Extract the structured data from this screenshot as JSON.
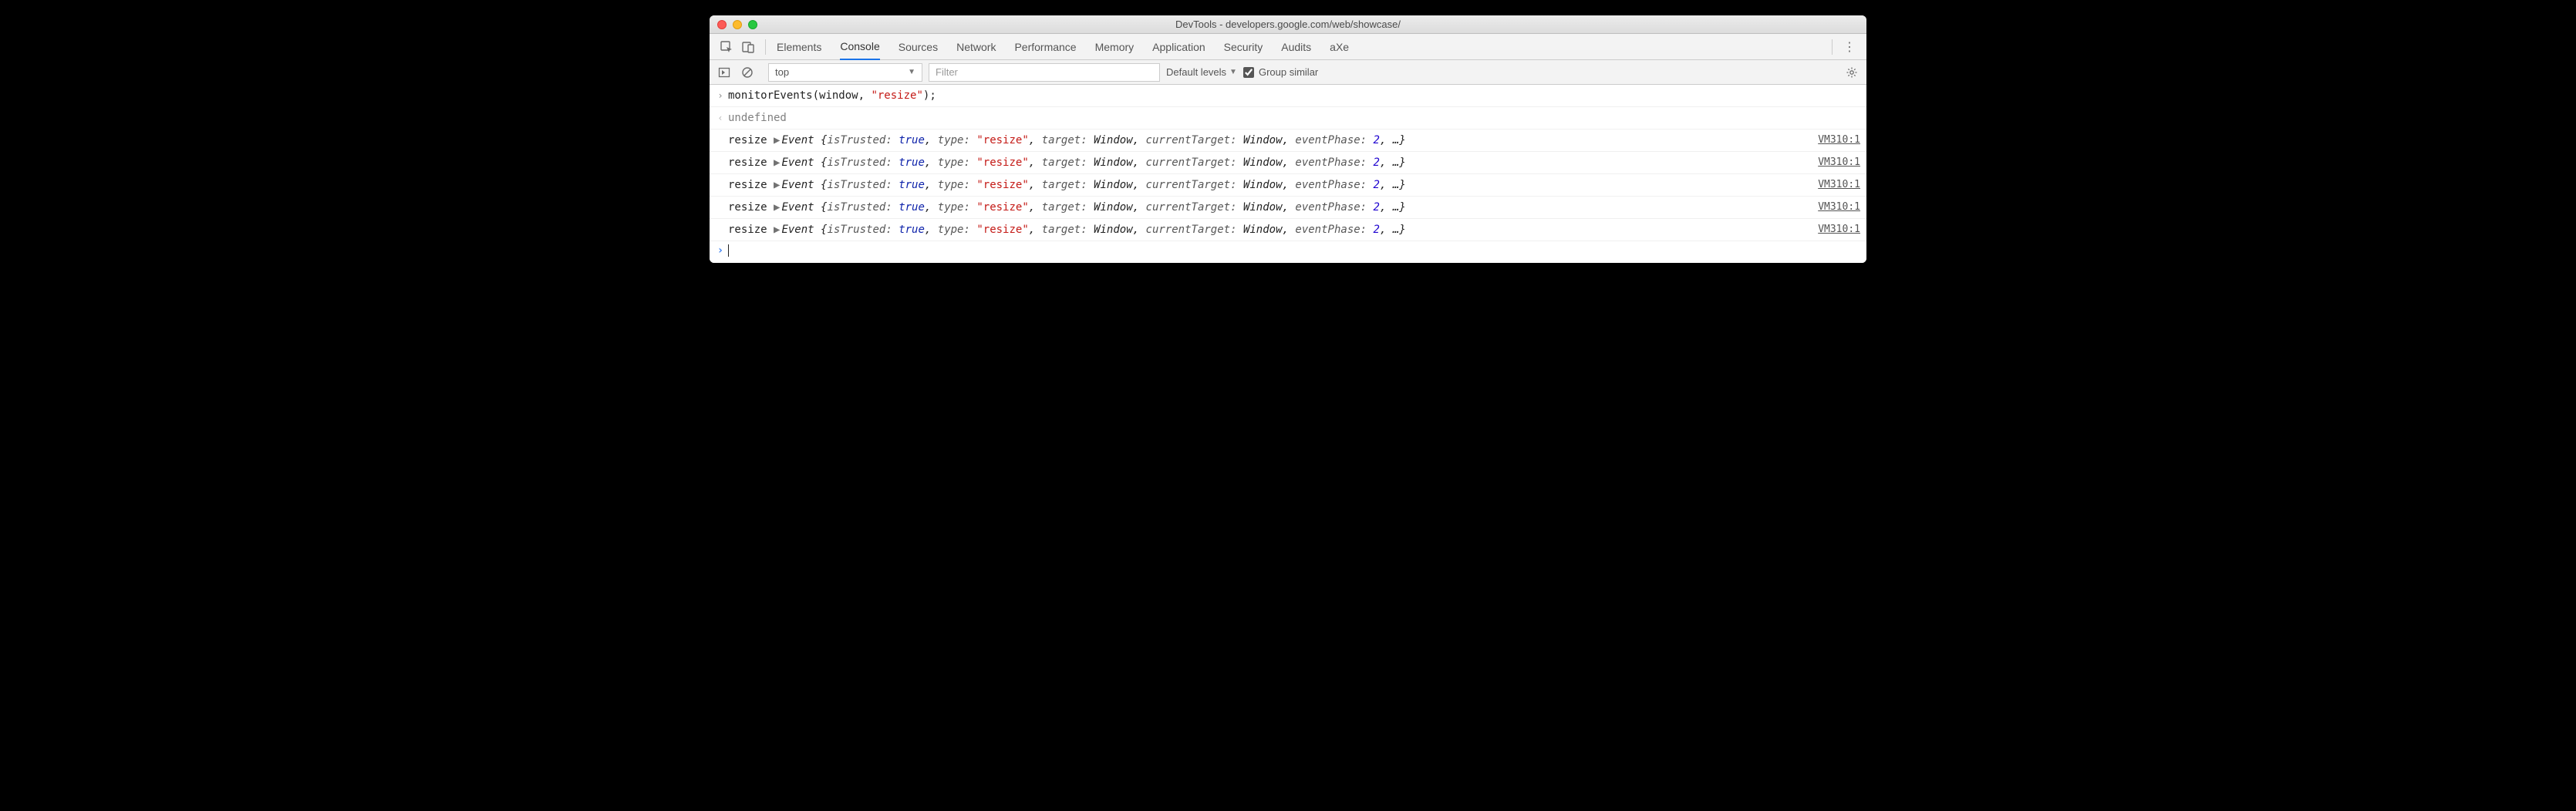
{
  "window": {
    "title": "DevTools - developers.google.com/web/showcase/"
  },
  "tabs": {
    "items": [
      "Elements",
      "Console",
      "Sources",
      "Network",
      "Performance",
      "Memory",
      "Application",
      "Security",
      "Audits",
      "aXe"
    ],
    "active": "Console"
  },
  "toolbar": {
    "context": "top",
    "filter_placeholder": "Filter",
    "levels_label": "Default levels",
    "group_label": "Group similar",
    "group_checked": true
  },
  "console": {
    "input_line": {
      "fn": "monitorEvents",
      "arg1": "window",
      "arg2": "\"resize\""
    },
    "result": "undefined",
    "events": [
      {
        "name": "resize",
        "cls": "Event",
        "props": {
          "isTrusted": "true",
          "type": "\"resize\"",
          "target": "Window",
          "currentTarget": "Window",
          "eventPhase": "2"
        },
        "source": "VM310:1"
      },
      {
        "name": "resize",
        "cls": "Event",
        "props": {
          "isTrusted": "true",
          "type": "\"resize\"",
          "target": "Window",
          "currentTarget": "Window",
          "eventPhase": "2"
        },
        "source": "VM310:1"
      },
      {
        "name": "resize",
        "cls": "Event",
        "props": {
          "isTrusted": "true",
          "type": "\"resize\"",
          "target": "Window",
          "currentTarget": "Window",
          "eventPhase": "2"
        },
        "source": "VM310:1"
      },
      {
        "name": "resize",
        "cls": "Event",
        "props": {
          "isTrusted": "true",
          "type": "\"resize\"",
          "target": "Window",
          "currentTarget": "Window",
          "eventPhase": "2"
        },
        "source": "VM310:1"
      },
      {
        "name": "resize",
        "cls": "Event",
        "props": {
          "isTrusted": "true",
          "type": "\"resize\"",
          "target": "Window",
          "currentTarget": "Window",
          "eventPhase": "2"
        },
        "source": "VM310:1"
      }
    ]
  }
}
